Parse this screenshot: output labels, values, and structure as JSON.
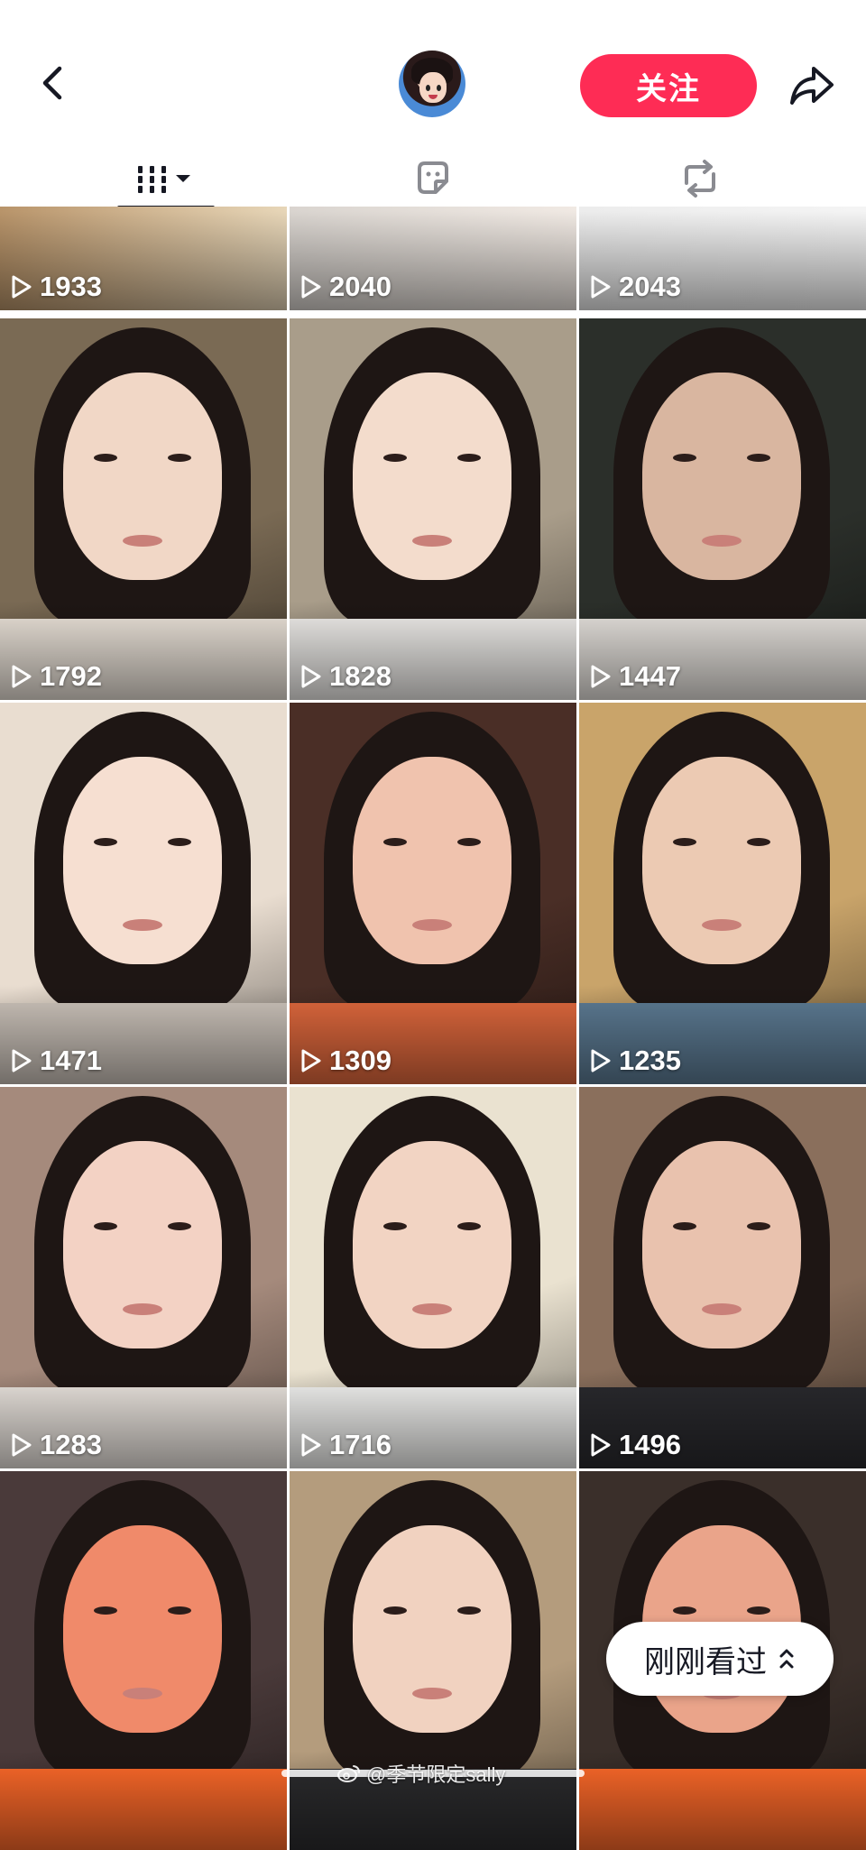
{
  "header": {
    "follow_label": "关注",
    "accent_color": "#fe2c55"
  },
  "tabs": [
    {
      "id": "works",
      "icon": "grid-icon",
      "active": true
    },
    {
      "id": "likes",
      "icon": "sticker-icon",
      "active": false
    },
    {
      "id": "reposts",
      "icon": "repost-icon",
      "active": false
    }
  ],
  "videos": [
    {
      "views": "1933"
    },
    {
      "views": "2040"
    },
    {
      "views": "2043"
    },
    {
      "views": "1792"
    },
    {
      "views": "1828"
    },
    {
      "views": "1447"
    },
    {
      "views": "1471"
    },
    {
      "views": "1309"
    },
    {
      "views": "1235"
    },
    {
      "views": "1283"
    },
    {
      "views": "1716"
    },
    {
      "views": "1496"
    },
    {
      "views": ""
    },
    {
      "views": ""
    },
    {
      "views": ""
    }
  ],
  "recent_pill": {
    "label": "刚刚看过"
  },
  "watermark": {
    "text": "@季节限定sally"
  }
}
